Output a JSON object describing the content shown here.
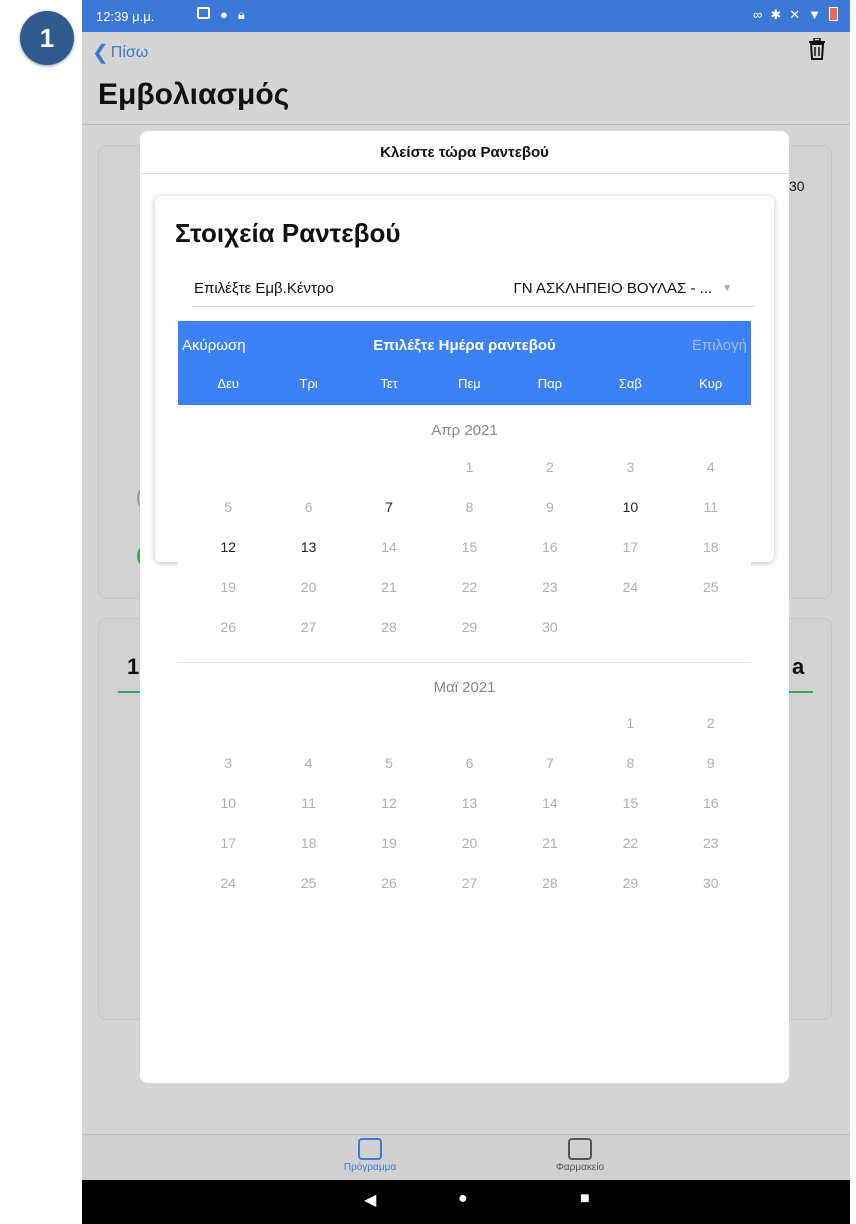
{
  "step_badge": "1",
  "status_bar": {
    "time": "12:39 μ.μ."
  },
  "nav": {
    "back_label": "Πίσω"
  },
  "page": {
    "title": "Εμβολιασμός"
  },
  "modal": {
    "header": "Κλείστε τώρα Ραντεβού",
    "card": {
      "title": "Στοιχεία Ραντεβού",
      "center_label": "Επιλέξτε Εμβ.Κέντρο",
      "center_value": "ΓΝ ΑΣΚΛΗΠΕΙΟ ΒΟΥΛΑΣ - ..."
    }
  },
  "calendar": {
    "cancel_label": "Ακύρωση",
    "title": "Επιλέξτε Ημέρα ραντεβού",
    "select_label": "Επιλογή",
    "weekdays": [
      "Δευ",
      "Τρι",
      "Τετ",
      "Πεμ",
      "Παρ",
      "Σαβ",
      "Κυρ"
    ],
    "months": [
      {
        "label": "Απρ 2021",
        "leading_blanks": 3,
        "days": 30,
        "available": [
          7,
          10,
          12,
          13
        ]
      },
      {
        "label": "Μαϊ 2021",
        "leading_blanks": 5,
        "days": 30,
        "available": []
      }
    ]
  },
  "background": {
    "right_partial_text": "30",
    "section_number": "1",
    "section_right_text": "a"
  },
  "tabs": [
    {
      "label": "Πρόγραμμα",
      "icon": "calendar-icon",
      "active": true,
      "color": "#3c78d8"
    },
    {
      "label": "Φαρμακείο",
      "icon": "inbox-icon",
      "active": false,
      "color": "#555555"
    }
  ]
}
